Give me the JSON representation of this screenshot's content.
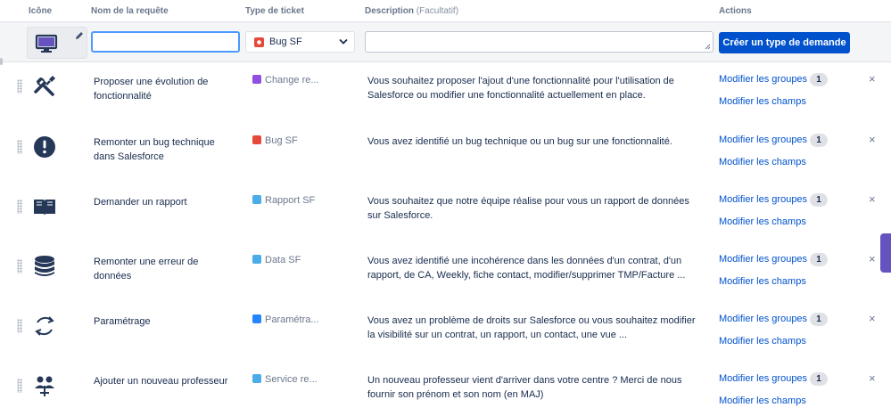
{
  "columns": {
    "icon": "Icône",
    "name": "Nom de la requête",
    "ticket_type": "Type de ticket",
    "description": "Description",
    "description_optional": "(Facultatif)",
    "actions": "Actions"
  },
  "create_form": {
    "name_value": "",
    "ticket_type_selected": "Bug SF",
    "description_value": "",
    "create_button": "Créer un type de demande"
  },
  "actions": {
    "edit_groups": "Modifier les groupes",
    "edit_fields": "Modifier les champs",
    "remove_symbol": "×"
  },
  "colors": {
    "primary_button": "#0052cc",
    "link": "#0052cc",
    "bug": "#e5493a",
    "change": "#904ee2",
    "task": "#4bade8",
    "data": "#4bade8",
    "config": "#2684ff",
    "service": "#4bade8"
  },
  "request_types": [
    {
      "icon": "tools-icon",
      "name": "Proposer une évolution de fonctionnalité",
      "ticket_type": "Change re...",
      "ticket_icon": "change-icon",
      "ticket_color": "#904ee2",
      "description": "Vous souhaitez proposer l'ajout d'une fonctionnalité pour l'utilisation de Salesforce ou modifier une fonctionnalité actuellement en place.",
      "groups_count": "1"
    },
    {
      "icon": "alert-icon",
      "name": "Remonter un bug technique dans Salesforce",
      "ticket_type": "Bug SF",
      "ticket_icon": "bug-icon",
      "ticket_color": "#e5493a",
      "description": "Vous avez identifié un bug technique ou un bug sur une fonctionnalité.",
      "groups_count": "1"
    },
    {
      "icon": "book-icon",
      "name": "Demander un rapport",
      "ticket_type": "Rapport SF",
      "ticket_icon": "task-check-icon",
      "ticket_color": "#4bade8",
      "description": "Vous souhaitez que notre équipe réalise pour vous un rapport de données sur Salesforce.",
      "groups_count": "1"
    },
    {
      "icon": "database-icon",
      "name": "Remonter une erreur de données",
      "ticket_type": "Data SF",
      "ticket_icon": "shield-icon",
      "ticket_color": "#4bade8",
      "description": "Vous avez identifié une incohérence dans les données d'un contrat, d'un rapport, de CA, Weekly, fiche contact, modifier/supprimer TMP/Facture ...",
      "groups_count": "1"
    },
    {
      "icon": "sync-icon",
      "name": "Paramétrage",
      "ticket_type": "Paramétra...",
      "ticket_icon": "code-icon",
      "ticket_color": "#2684ff",
      "description": "Vous avez un problème de droits sur Salesforce ou vous souhaitez modifier la visibilité sur un contrat, un rapport, un contact, une vue ...",
      "groups_count": "1"
    },
    {
      "icon": "people-icon",
      "name": "Ajouter un nouveau professeur",
      "ticket_type": "Service re...",
      "ticket_icon": "service-icon",
      "ticket_color": "#4bade8",
      "description": "Un nouveau professeur vient d'arriver dans votre centre ? Merci de nous fournir son prénom et son nom (en MAJ)",
      "groups_count": "1"
    }
  ]
}
